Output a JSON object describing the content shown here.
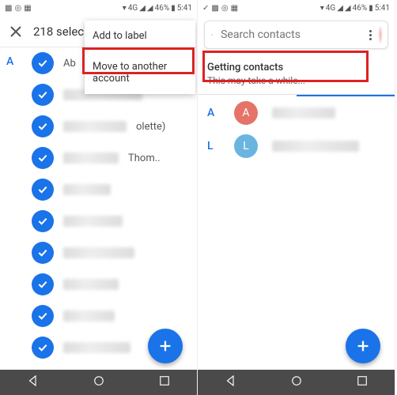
{
  "status": {
    "signal": "4G",
    "battery": "46%",
    "time": "5:41"
  },
  "left": {
    "header_title": "218 selec",
    "menu": {
      "item1": "Add to label",
      "item2": "Move to another account"
    },
    "section_letter": "A",
    "visible_names": {
      "r0": "Ab",
      "r2_suffix": "olette)",
      "r3_suffix": "Thom.."
    }
  },
  "right": {
    "search_placeholder": "Search contacts",
    "loading_title": "Getting contacts",
    "loading_sub": "This may take a while...",
    "sections": {
      "a": "A",
      "l": "L"
    }
  },
  "nav": {},
  "fab": {},
  "colors": {
    "accent": "#1a73e8",
    "highlight": "#d22"
  }
}
